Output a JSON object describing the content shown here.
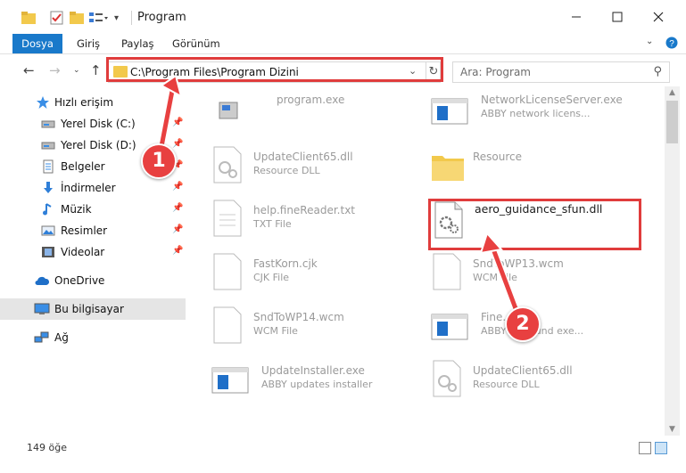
{
  "window": {
    "title": "Program"
  },
  "ribbon": {
    "tabs": [
      "Dosya",
      "Giriş",
      "Paylaş",
      "Görünüm"
    ]
  },
  "address": {
    "path": "C:\\Program Files\\Program Dizini"
  },
  "search": {
    "placeholder": "Ara: Program"
  },
  "navpane": {
    "items": [
      {
        "label": "Hızlı erişim",
        "icon": "star-icon"
      },
      {
        "label": "Yerel Disk (C:)",
        "icon": "drive-icon"
      },
      {
        "label": "Yerel Disk (D:)",
        "icon": "drive-icon"
      },
      {
        "label": "Belgeler",
        "icon": "documents-icon"
      },
      {
        "label": "İndirmeler",
        "icon": "downloads-icon"
      },
      {
        "label": "Müzik",
        "icon": "music-icon"
      },
      {
        "label": "Resimler",
        "icon": "pictures-icon"
      },
      {
        "label": "Videolar",
        "icon": "videos-icon"
      },
      {
        "label": "OneDrive",
        "icon": "cloud-icon"
      },
      {
        "label": "Bu bilgisayar",
        "icon": "computer-icon"
      },
      {
        "label": "Ağ",
        "icon": "network-icon"
      }
    ]
  },
  "files": [
    {
      "name": "program.exe",
      "type": "",
      "kind": "exe"
    },
    {
      "name": "NetworkLicenseServer.exe",
      "type": "ABBY network licens...",
      "kind": "app"
    },
    {
      "name": "UpdateClient65.dll",
      "type": "Resource DLL",
      "kind": "dll"
    },
    {
      "name": "Resource",
      "type": "",
      "kind": "folder"
    },
    {
      "name": "help.fineReader.txt",
      "type": "TXT File",
      "kind": "txt"
    },
    {
      "name": "aero_guidance_sfun.dll",
      "type": "",
      "kind": "dll"
    },
    {
      "name": "FastKorn.cjk",
      "type": "CJK File",
      "kind": "file"
    },
    {
      "name": "SndToWP13.wcm",
      "type": "WCM File",
      "kind": "file"
    },
    {
      "name": "SndToWP14.wcm",
      "type": "WCM File",
      "kind": "file"
    },
    {
      "name": "Fine...exe",
      "type": "ABBY ...ground exe...",
      "kind": "app"
    },
    {
      "name": "UpdateInstaller.exe",
      "type": "ABBY updates installer",
      "kind": "app"
    },
    {
      "name": "UpdateClient65.dll",
      "type": "Resource DLL",
      "kind": "dll"
    }
  ],
  "status": {
    "count": "149 öğe"
  },
  "callouts": {
    "one": "1",
    "two": "2"
  },
  "colors": {
    "accent": "#1979ca",
    "highlight": "#e03c3c",
    "callout": "#e84040"
  }
}
